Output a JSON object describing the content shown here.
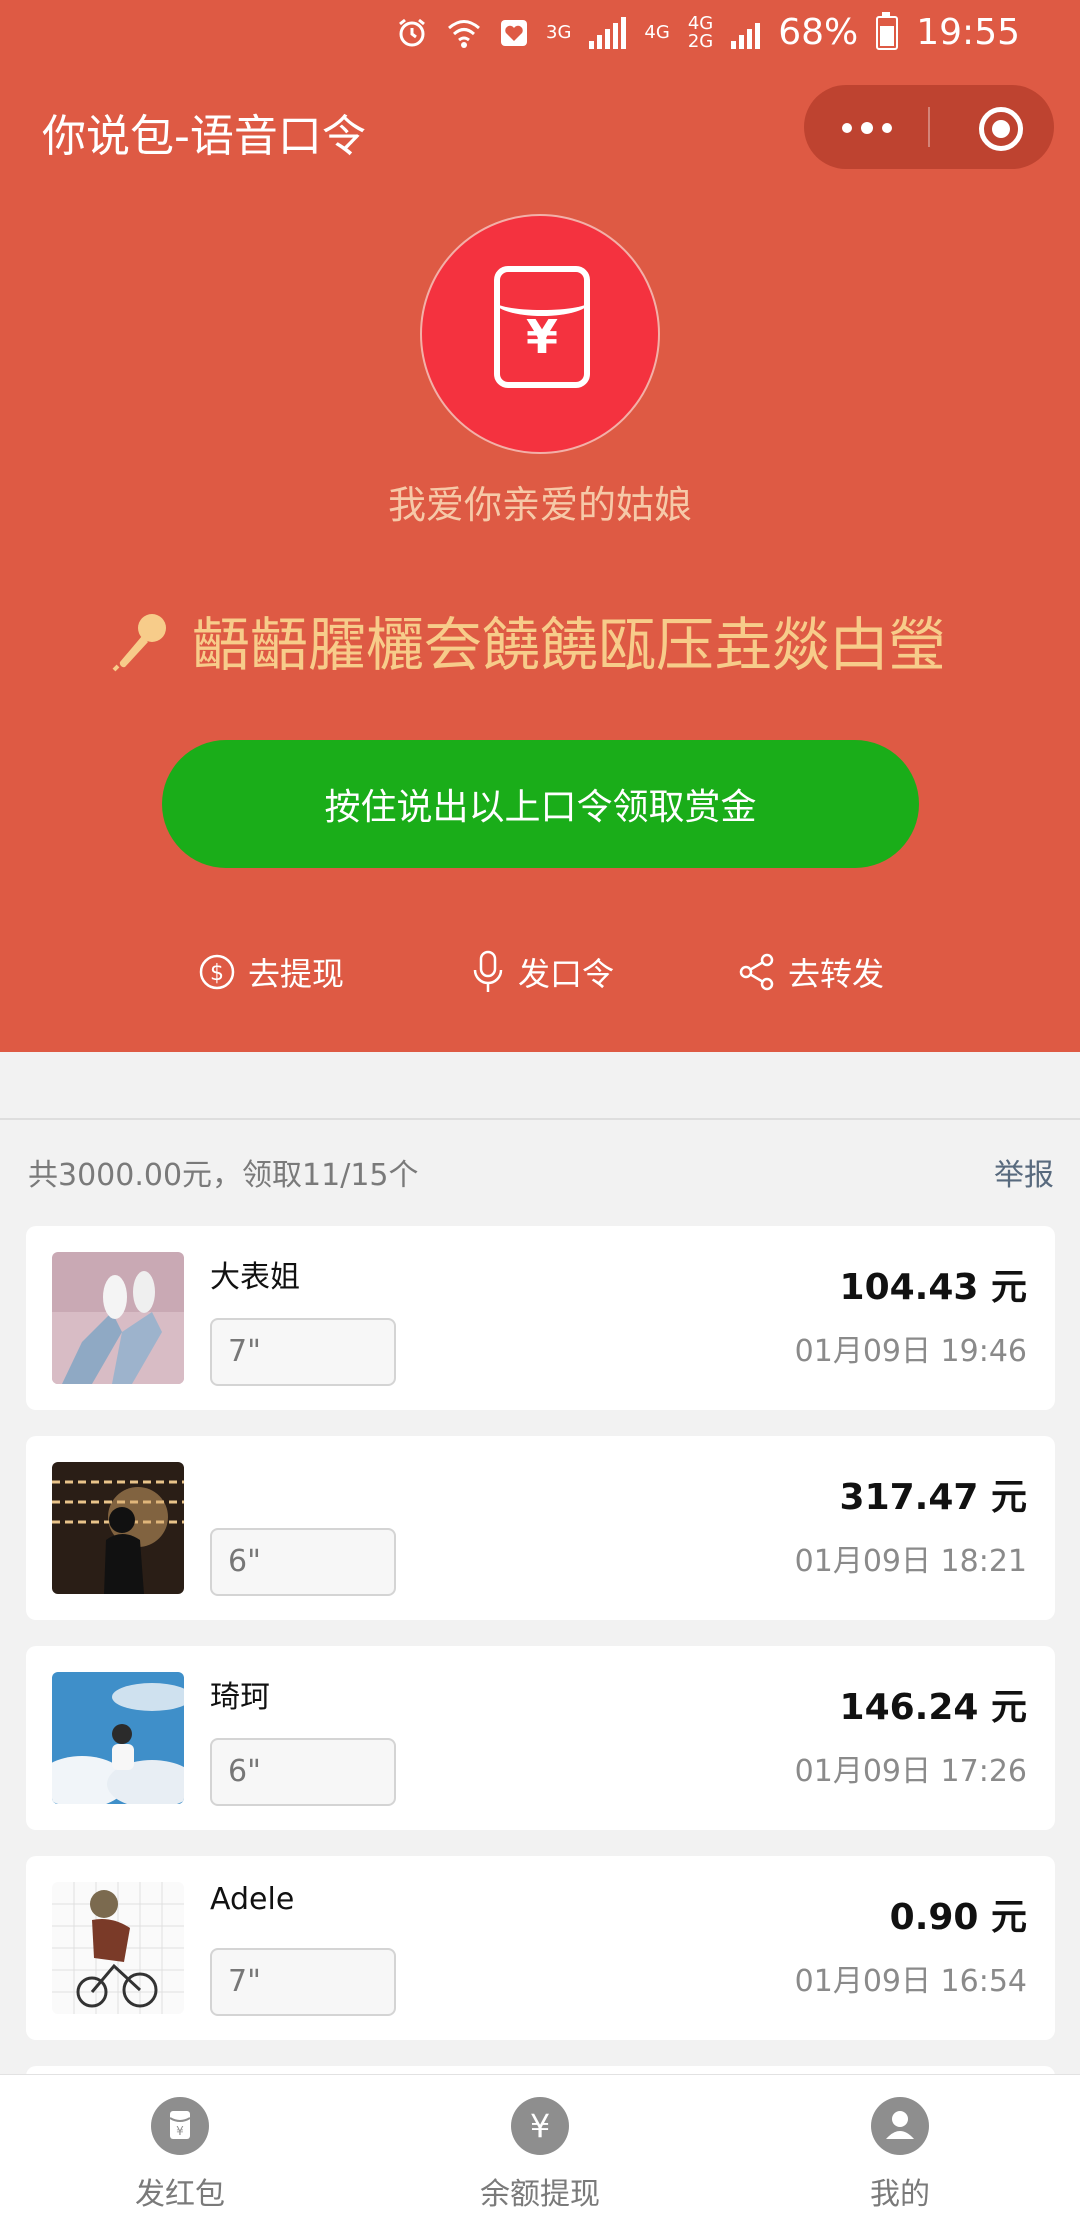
{
  "status_bar": {
    "net1": "3G",
    "net2": "4G",
    "net3a": "4G",
    "net3b": "2G",
    "battery": "68%",
    "time": "19:55"
  },
  "header": {
    "title": "你说包-语音口令"
  },
  "hero": {
    "envelope_symbol": "¥",
    "subtitle": "我爱你亲爱的姑娘",
    "command": "齬齬臛欐夽饒饒瓯压垚燚甴瑩",
    "speak_button": "按住说出以上口令领取赏金"
  },
  "actions": {
    "withdraw": "去提现",
    "send_command": "发口令",
    "share": "去转发"
  },
  "summary": {
    "text": "共3000.00元，领取11/15个",
    "report": "举报"
  },
  "records": [
    {
      "name": "大表姐",
      "duration": "7\"",
      "amount": "104.43 元",
      "time": "01月09日 19:46"
    },
    {
      "name": "",
      "duration": "6\"",
      "amount": "317.47 元",
      "time": "01月09日 18:21"
    },
    {
      "name": "琦珂",
      "duration": "6\"",
      "amount": "146.24 元",
      "time": "01月09日 17:26"
    },
    {
      "name": "Adele",
      "duration": "7\"",
      "amount": "0.90 元",
      "time": "01月09日 16:54"
    }
  ],
  "tabbar": {
    "tab1": "发红包",
    "tab2": "余额提现",
    "tab3": "我的",
    "tab2_symbol": "¥"
  },
  "colors": {
    "header_bg": "#de5a44",
    "button_green": "#1aad19",
    "command_gold": "#f7cc8a"
  }
}
